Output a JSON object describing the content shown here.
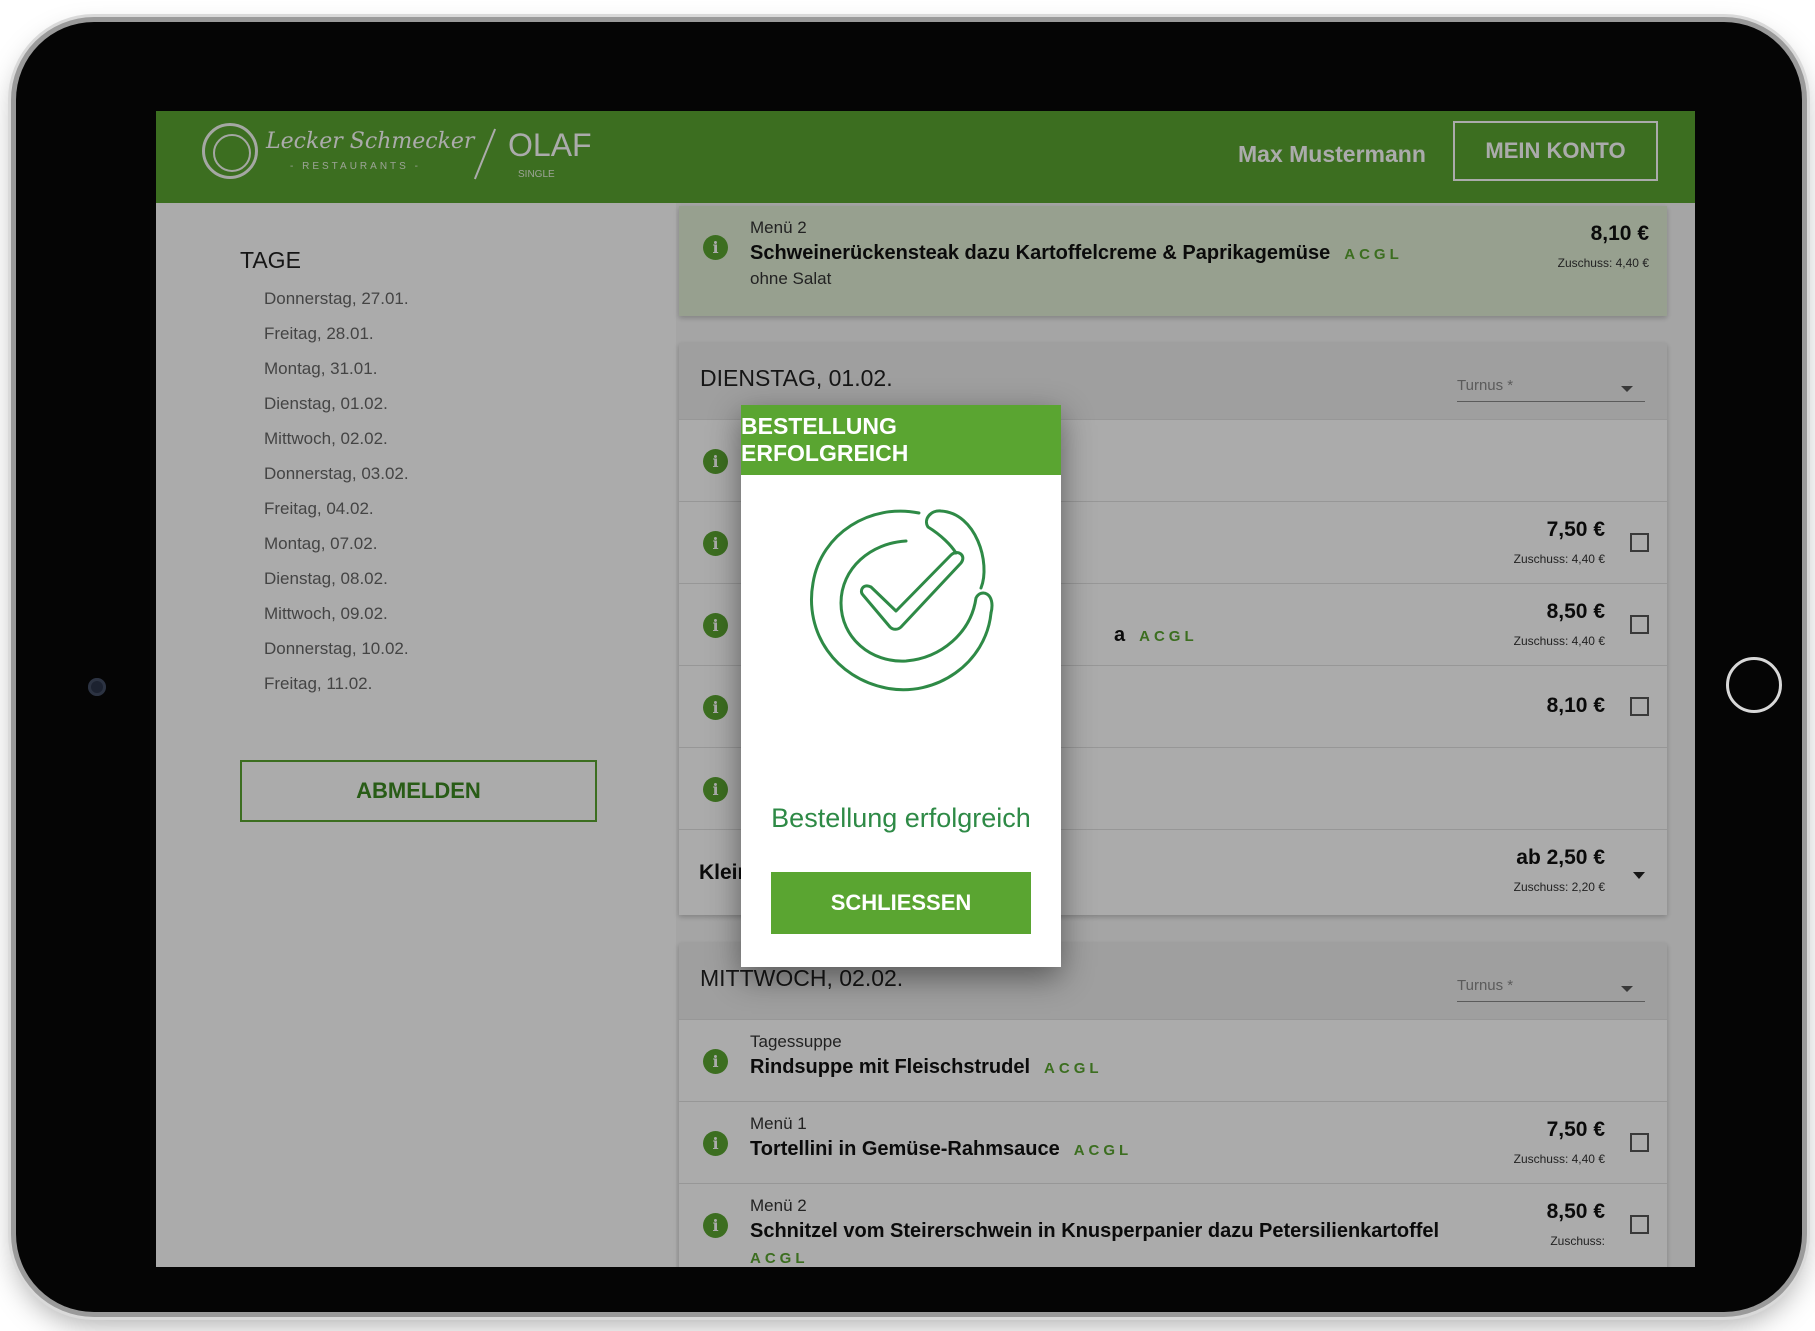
{
  "header": {
    "brand_name": "Lecker Schmecker",
    "brand_sub": "- RESTAURANTS -",
    "product_name": "OLAF",
    "product_sub": "SINGLE",
    "user_name": "Max Mustermann",
    "account_button": "MEIN KONTO"
  },
  "sidebar": {
    "title": "TAGE",
    "days": [
      "Donnerstag, 27.01.",
      "Freitag, 28.01.",
      "Montag, 31.01.",
      "Dienstag, 01.02.",
      "Mittwoch, 02.02.",
      "Donnerstag, 03.02.",
      "Freitag, 04.02.",
      "Montag, 07.02.",
      "Dienstag, 08.02.",
      "Mittwoch, 09.02.",
      "Donnerstag, 10.02.",
      "Freitag, 11.02."
    ],
    "logout_button": "ABMELDEN"
  },
  "selected_item": {
    "label": "Menü 2",
    "title": "Schweinerückensteak dazu Kartoffelcreme & Paprikagemüse",
    "allergens": "ACGL",
    "note": "ohne Salat",
    "price": "8,10 €",
    "subsidy": "Zuschuss: 4,40 €"
  },
  "tuesday": {
    "title": "DIENSTAG, 01.02.",
    "turnus_label": "Turnus *",
    "rows": [
      {
        "price": "",
        "subsidy": "",
        "allergens": ""
      },
      {
        "price": "7,50 €",
        "subsidy": "Zuschuss: 4,40 €",
        "allergens": ""
      },
      {
        "title_tail": "a",
        "price": "8,50 €",
        "subsidy": "Zuschuss: 4,40 €",
        "allergens": "ACGL"
      },
      {
        "price": "8,10 €",
        "subsidy": "",
        "allergens": ""
      },
      {
        "price": "",
        "subsidy": "",
        "allergens": ""
      }
    ],
    "small_row": {
      "title": "Klein",
      "price": "ab 2,50 €",
      "subsidy": "Zuschuss: 2,20 €"
    }
  },
  "wednesday": {
    "title": "MITTWOCH, 02.02.",
    "turnus_label": "Turnus *",
    "rows": [
      {
        "label": "Tagessuppe",
        "title": "Rindsuppe mit Fleischstrudel",
        "allergens": "ACGL",
        "price": "",
        "subsidy": ""
      },
      {
        "label": "Menü 1",
        "title": "Tortellini in Gemüse-Rahmsauce",
        "allergens": "ACGL",
        "price": "7,50 €",
        "subsidy": "Zuschuss: 4,40 €"
      },
      {
        "label": "Menü 2",
        "title": "Schnitzel vom Steirerschwein in Knusperpanier dazu Petersilienkartoffel",
        "allergens": "ACGL",
        "price": "8,50 €",
        "subsidy": "Zuschuss:"
      }
    ]
  },
  "dialog": {
    "title": "BESTELLUNG ERFOLGREICH",
    "message": "Bestellung erfolgreich",
    "close_button": "SCHLIESSEN",
    "icon": "success-check-icon"
  },
  "colors": {
    "brand_green": "#5aa531",
    "success_green": "#2e8a46",
    "selected_row": "#e1efd6"
  }
}
